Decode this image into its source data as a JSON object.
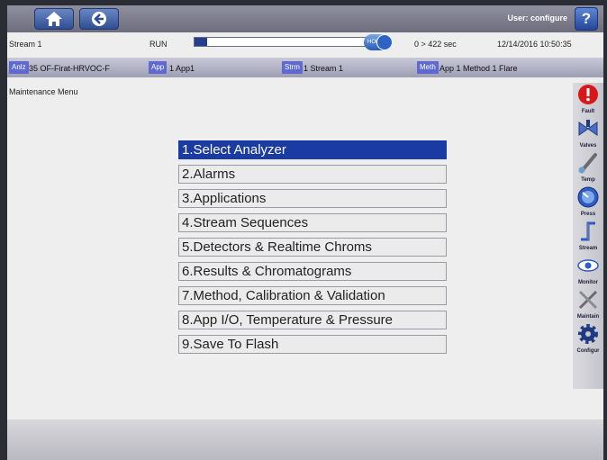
{
  "header": {
    "user": "User: configure",
    "help": "?"
  },
  "status": {
    "stream": "Stream 1",
    "run": "RUN",
    "progress": 0.07,
    "hold": "HOLD",
    "time": "0 > 422 sec",
    "datetime": "12/14/2016 10:50:35"
  },
  "info": {
    "anlz_tag": "Anlz",
    "anlz_value": "35 OF-Firat-HRVOC-F",
    "app_tag": "App",
    "app_value": "1 App1",
    "strm_tag": "Strm",
    "strm_value": "1 Stream 1",
    "meth_tag": "Meth",
    "meth_value": "App 1 Method 1 Flare"
  },
  "menu_title": "Maintenance Menu",
  "menu": [
    "1.Select Analyzer",
    "2.Alarms",
    "3.Applications",
    "4.Stream Sequences",
    "5.Detectors & Realtime Chroms",
    "6.Results & Chromatograms",
    "7.Method, Calibration & Validation",
    "8.App I/O, Temperature & Pressure",
    "9.Save To Flash"
  ],
  "sidebar": [
    "Fault",
    "Valves",
    "Temp",
    "Press",
    "Stream",
    "Monitor",
    "Maintain",
    "Configur"
  ]
}
